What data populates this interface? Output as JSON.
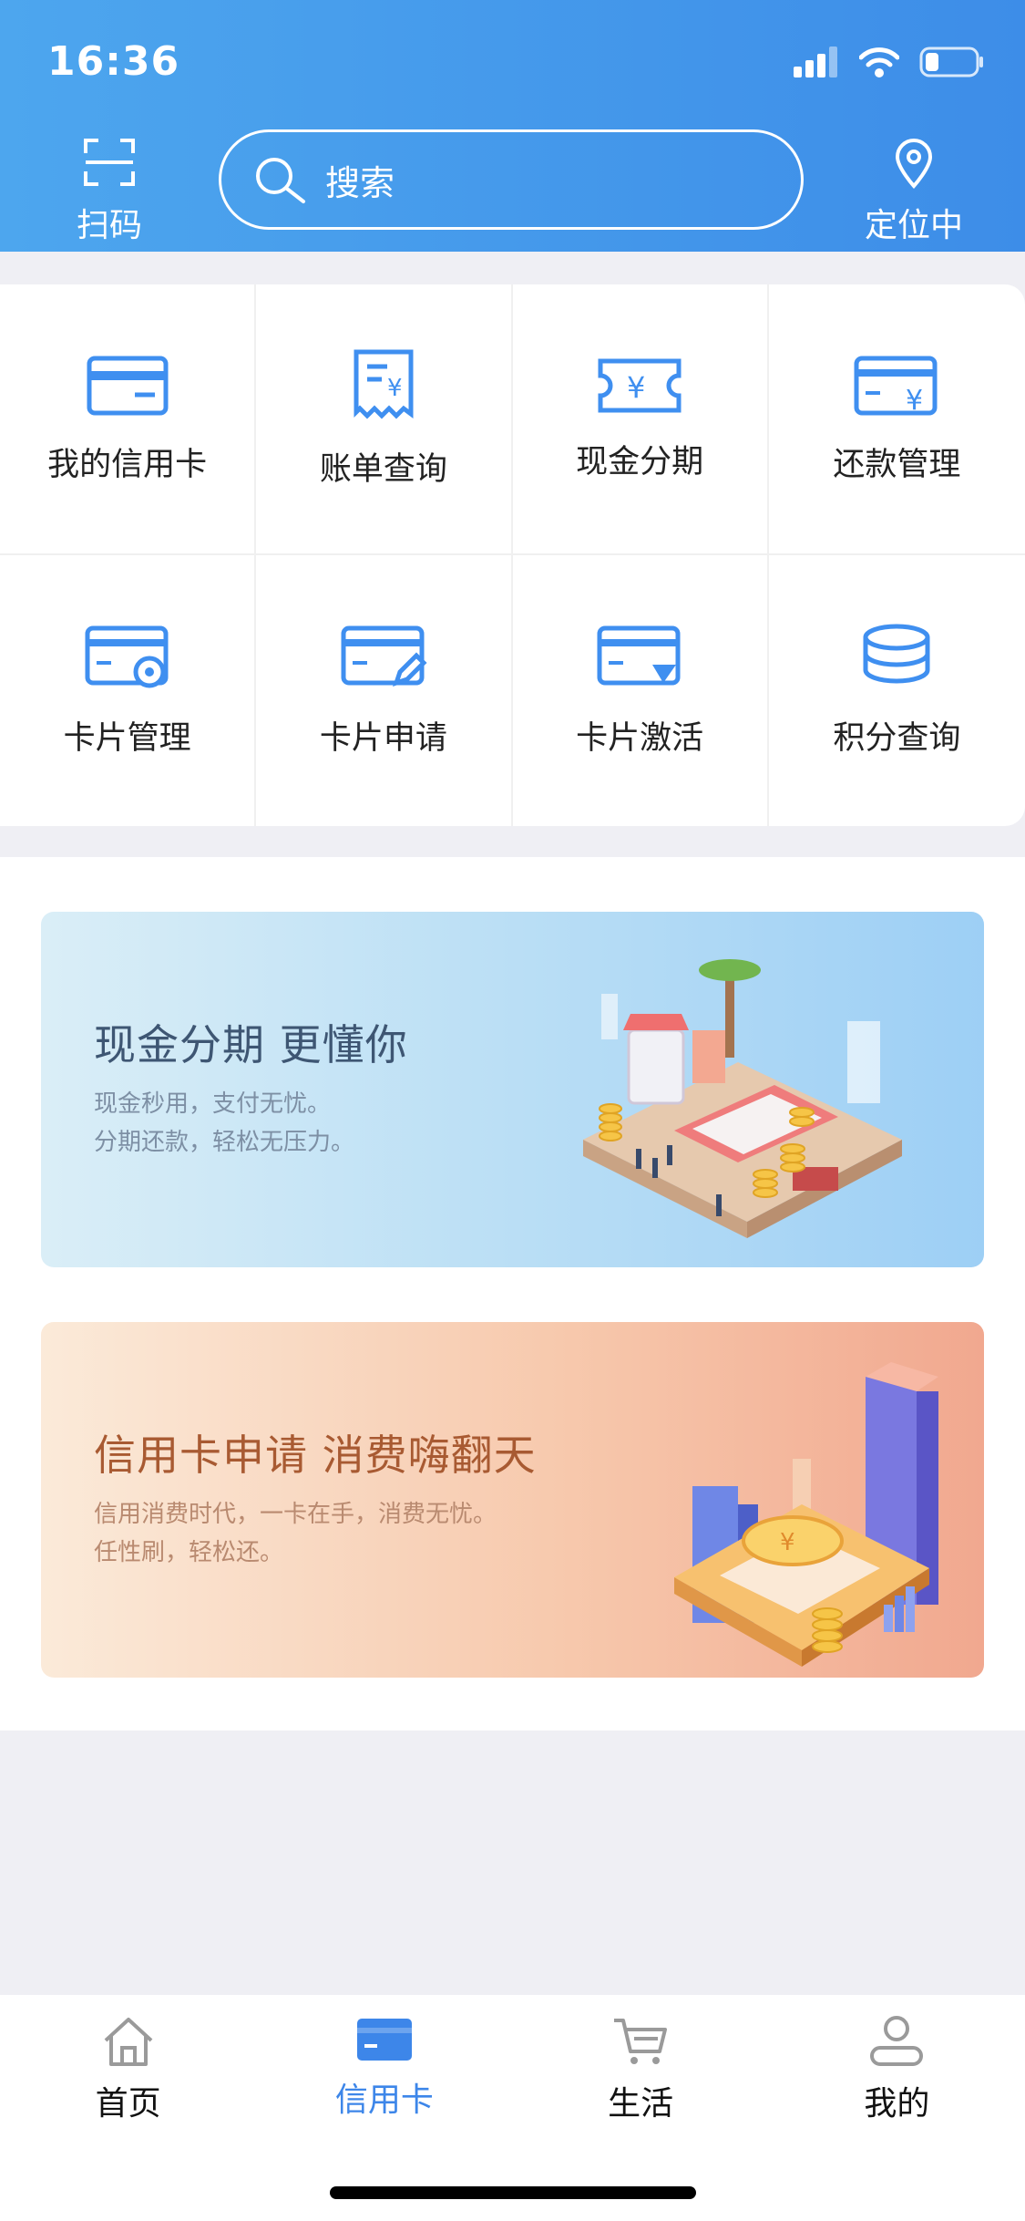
{
  "status_bar": {
    "time": "16:36"
  },
  "header": {
    "scan_label": "扫码",
    "search_placeholder": "搜索",
    "location_label": "定位中"
  },
  "grid": [
    {
      "label": "我的信用卡",
      "icon": "credit-card-icon"
    },
    {
      "label": "账单查询",
      "icon": "bill-icon"
    },
    {
      "label": "现金分期",
      "icon": "cash-ticket-icon"
    },
    {
      "label": "还款管理",
      "icon": "repay-card-icon"
    },
    {
      "label": "卡片管理",
      "icon": "card-settings-icon"
    },
    {
      "label": "卡片申请",
      "icon": "card-edit-icon"
    },
    {
      "label": "卡片激活",
      "icon": "card-activate-icon"
    },
    {
      "label": "积分查询",
      "icon": "points-stack-icon"
    }
  ],
  "banners": [
    {
      "title": "现金分期 更懂你",
      "line1": "现金秒用，支付无忧。",
      "line2": "分期还款，轻松无压力。"
    },
    {
      "title": "信用卡申请 消费嗨翻天",
      "line1": "信用消费时代，一卡在手，消费无忧。",
      "line2": "任性刷，轻松还。"
    }
  ],
  "tabbar": [
    {
      "label": "首页",
      "icon": "home-icon"
    },
    {
      "label": "信用卡",
      "icon": "credit-card-icon",
      "active": true
    },
    {
      "label": "生活",
      "icon": "cart-icon"
    },
    {
      "label": "我的",
      "icon": "user-icon"
    }
  ],
  "colors": {
    "header": "#3d8de8",
    "accent": "#3d86e9",
    "icon_blue": "#3f8ff0"
  }
}
